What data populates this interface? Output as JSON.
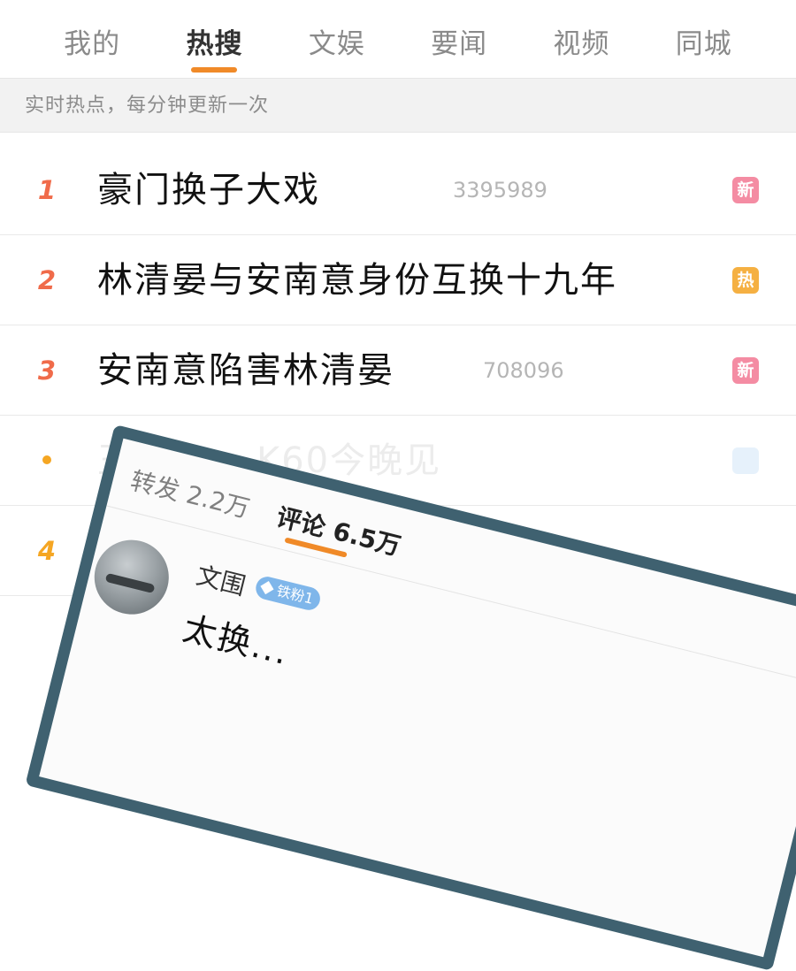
{
  "tabs": [
    {
      "label": "我的",
      "active": false
    },
    {
      "label": "热搜",
      "active": true
    },
    {
      "label": "文娱",
      "active": false
    },
    {
      "label": "要闻",
      "active": false
    },
    {
      "label": "视频",
      "active": false
    },
    {
      "label": "同城",
      "active": false
    }
  ],
  "hint": "实时热点，每分钟更新一次",
  "hot_list": [
    {
      "rank": "1",
      "title": "豪门换子大戏",
      "count": "3395989",
      "badge": "新"
    },
    {
      "rank": "2",
      "title": "林清晏与安南意身份互换十九年",
      "count": "",
      "badge": "热"
    },
    {
      "rank": "3",
      "title": "安南意陷害林清晏",
      "count": "708096",
      "badge": "新"
    },
    {
      "rank": "",
      "title": "王",
      "title_tail": "K60今晚见",
      "count": "",
      "badge": ""
    },
    {
      "rank": "4",
      "title": "",
      "count": "",
      "badge": ""
    }
  ],
  "overlay": {
    "tabs": [
      {
        "label": "转发 2.2万",
        "active": false
      },
      {
        "label": "评论 6.5万",
        "active": true
      }
    ],
    "comment": {
      "user": "文围",
      "fan_badge": "铁粉1",
      "text": "太换..."
    }
  },
  "colors": {
    "accent": "#f08a28",
    "rank_red": "#f06b4a",
    "rank_orange": "#f5a623",
    "badge_new": "#f48ca3",
    "badge_hot": "#f5b042",
    "frame": "#3f6170"
  }
}
